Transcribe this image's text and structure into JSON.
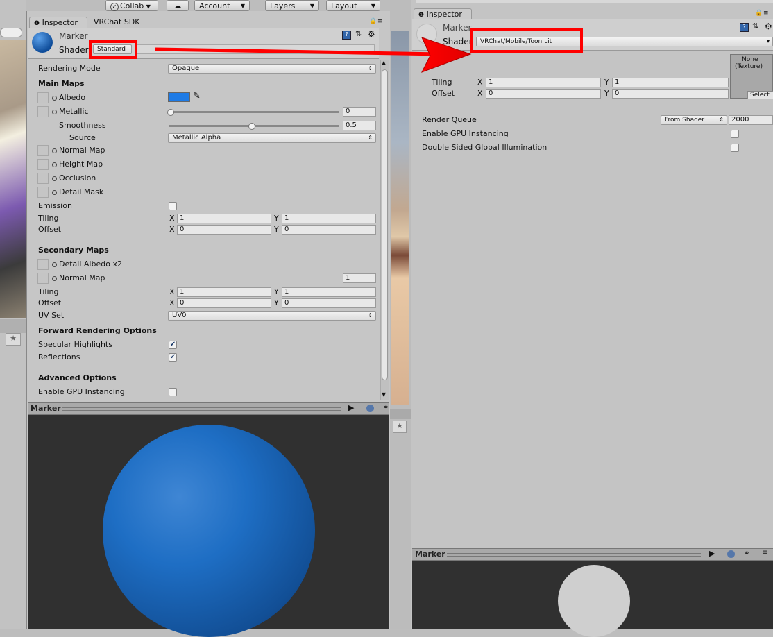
{
  "toolbar": {
    "collab": "Collab",
    "account": "Account",
    "layers": "Layers",
    "layout": "Layout",
    "collab_icon": "check-circle-icon",
    "cloud_icon": "cloud-icon"
  },
  "left_panel": {
    "tabs": [
      "Inspector",
      "VRChat SDK"
    ],
    "material_name": "Marker",
    "shader_label": "Shader",
    "shader_value": "Standard",
    "rendering_mode_label": "Rendering Mode",
    "rendering_mode_value": "Opaque",
    "main_maps_heading": "Main Maps",
    "albedo": "Albedo",
    "albedo_color": "#1e7be6",
    "metallic": "Metallic",
    "metallic_value": "0",
    "metallic_level": 0.0,
    "smoothness": "Smoothness",
    "smoothness_value": "0.5",
    "smoothness_level": 0.5,
    "source_label": "Source",
    "source_value": "Metallic Alpha",
    "normal_map": "Normal Map",
    "height_map": "Height Map",
    "occlusion": "Occlusion",
    "detail_mask": "Detail Mask",
    "emission": "Emission",
    "tiling": "Tiling",
    "offset": "Offset",
    "x": "X",
    "y": "Y",
    "tiling_x": "1",
    "tiling_y": "1",
    "offset_x": "0",
    "offset_y": "0",
    "secondary_maps_heading": "Secondary Maps",
    "detail_albedo": "Detail Albedo x2",
    "normal_map2": "Normal Map",
    "normal_map2_value": "1",
    "tiling2_x": "1",
    "tiling2_y": "1",
    "offset2_x": "0",
    "offset2_y": "0",
    "uv_set_label": "UV Set",
    "uv_set_value": "UV0",
    "forward_heading": "Forward Rendering Options",
    "specular": "Specular Highlights",
    "reflections": "Reflections",
    "advanced_heading": "Advanced Options",
    "gpu_instancing": "Enable GPU Instancing",
    "preview_title": "Marker",
    "sphere_color": "#1e6ec4"
  },
  "right_panel": {
    "tab": "Inspector",
    "material_name": "Marker",
    "shader_label": "Shader",
    "shader_value": "VRChat/Mobile/Toon Lit",
    "texture_none": "None",
    "texture_type": "(Texture)",
    "select": "Select",
    "tiling": "Tiling",
    "offset": "Offset",
    "x": "X",
    "y": "Y",
    "tiling_x": "1",
    "tiling_y": "1",
    "offset_x": "0",
    "offset_y": "0",
    "render_queue_label": "Render Queue",
    "render_queue_mode": "From Shader",
    "render_queue_value": "2000",
    "gpu_instancing": "Enable GPU Instancing",
    "double_sided_gi": "Double Sided Global Illumination",
    "preview_title": "Marker",
    "sphere_color": "#cfcfcf"
  },
  "annotation_color": "#ff0000"
}
